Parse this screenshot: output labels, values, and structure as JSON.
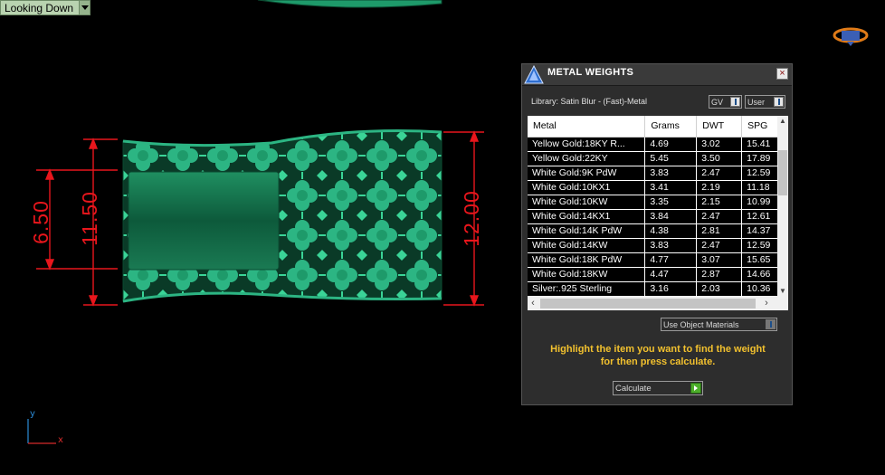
{
  "viewport": {
    "label": "Looking Down"
  },
  "dimensions": {
    "inner_height": "6.50",
    "outer_height": "11.50",
    "right_height": "12.00"
  },
  "axis": {
    "y": "y",
    "x": "x"
  },
  "colors": {
    "model_green": "#1e9a6a",
    "dimension_red": "#e8161c",
    "instruction_yellow": "#f2c12e"
  },
  "panel": {
    "title": "METAL WEIGHTS",
    "close_label": "×",
    "library": "Library: Satin Blur - (Fast)-Metal",
    "gv_select": "GV",
    "user_select": "User",
    "columns": [
      "Metal",
      "Grams",
      "DWT",
      "SPG"
    ],
    "rows": [
      [
        "Yellow Gold:18KY R...",
        "4.69",
        "3.02",
        "15.41"
      ],
      [
        "Yellow Gold:22KY",
        "5.45",
        "3.50",
        "17.89"
      ],
      [
        "White Gold:9K PdW",
        "3.83",
        "2.47",
        "12.59"
      ],
      [
        "White Gold:10KX1",
        "3.41",
        "2.19",
        "11.18"
      ],
      [
        "White Gold:10KW",
        "3.35",
        "2.15",
        "10.99"
      ],
      [
        "White Gold:14KX1",
        "3.84",
        "2.47",
        "12.61"
      ],
      [
        "White Gold:14K PdW",
        "4.38",
        "2.81",
        "14.37"
      ],
      [
        "White Gold:14KW",
        "3.83",
        "2.47",
        "12.59"
      ],
      [
        "White Gold:18K PdW",
        "4.77",
        "3.07",
        "15.65"
      ],
      [
        "White Gold:18KW",
        "4.47",
        "2.87",
        "14.66"
      ],
      [
        "Silver:.925 Sterling",
        "3.16",
        "2.03",
        "10.36"
      ]
    ],
    "use_object_materials": "Use Object Materials",
    "instructions_line1": "Highlight the item you want to find the weight",
    "instructions_line2": "for then press calculate.",
    "calculate_label": "Calculate"
  }
}
